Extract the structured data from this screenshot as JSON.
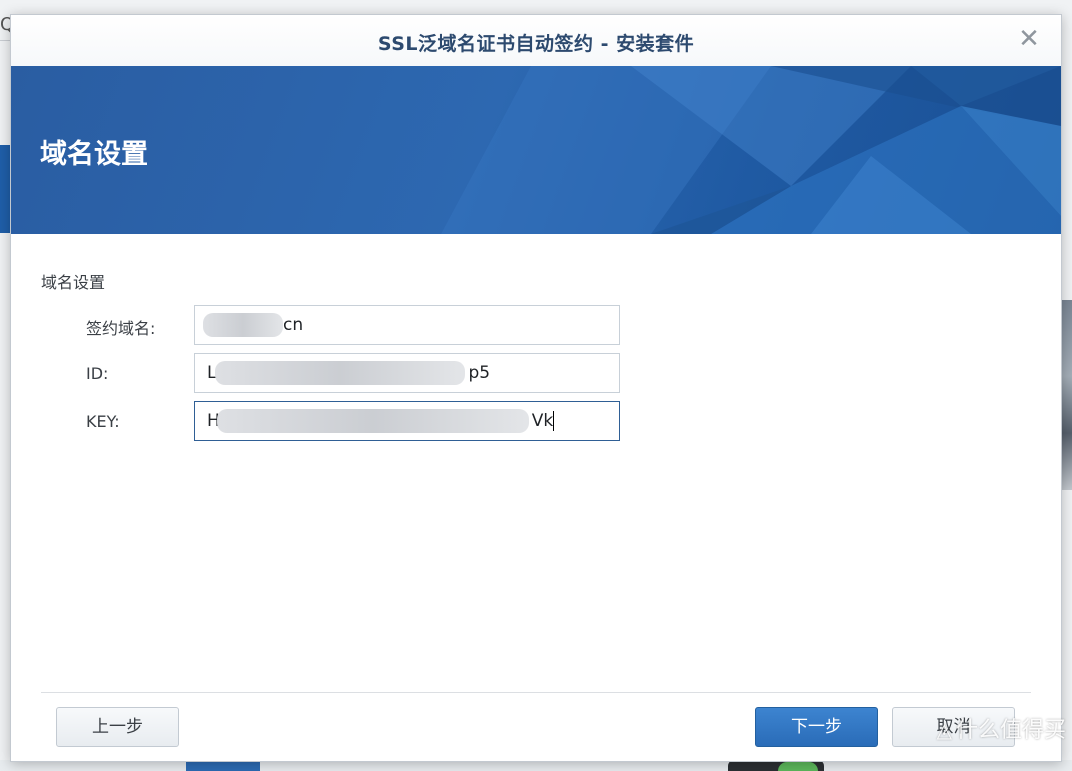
{
  "window": {
    "title": "SSL泛域名证书自动签约 - 安装套件",
    "close_glyph": "✕"
  },
  "banner": {
    "heading": "域名设置"
  },
  "form": {
    "section_title": "域名设置",
    "fields": [
      {
        "label": "签约域名:",
        "visible_value": "cn",
        "prefix": ""
      },
      {
        "label": "ID:",
        "visible_prefix": "L",
        "visible_suffix": "p5"
      },
      {
        "label": "KEY:",
        "visible_prefix": "H",
        "visible_suffix": "Vk"
      }
    ]
  },
  "buttons": {
    "prev": "上一步",
    "next": "下一步",
    "cancel": "取消"
  },
  "watermark": {
    "text": "什么值得买",
    "icon": "smzdm-logo-icon"
  },
  "background": {
    "search_glyph": "Q"
  },
  "colors": {
    "banner_blue": "#2d68b1",
    "primary_button": "#2a6cb8",
    "title_text": "#2d4a6f"
  }
}
